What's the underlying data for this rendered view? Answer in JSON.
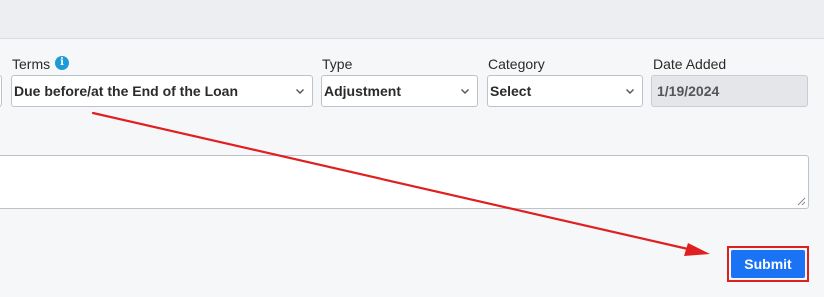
{
  "form": {
    "terms": {
      "label": "Terms",
      "value": "Due before/at the End of the Loan"
    },
    "type": {
      "label": "Type",
      "value": "Adjustment"
    },
    "category": {
      "label": "Category",
      "value": "Select"
    },
    "date_added": {
      "label": "Date Added",
      "value": "1/19/2024"
    },
    "notes": {
      "value": ""
    },
    "submit_label": "Submit"
  },
  "icons": {
    "terms_info": "info-icon",
    "dropdown": "chevron-down-icon",
    "resize": "resize-handle-icon"
  },
  "colors": {
    "accent": "#1a73f5",
    "annotation": "#e02020",
    "info": "#1e9bd7"
  }
}
